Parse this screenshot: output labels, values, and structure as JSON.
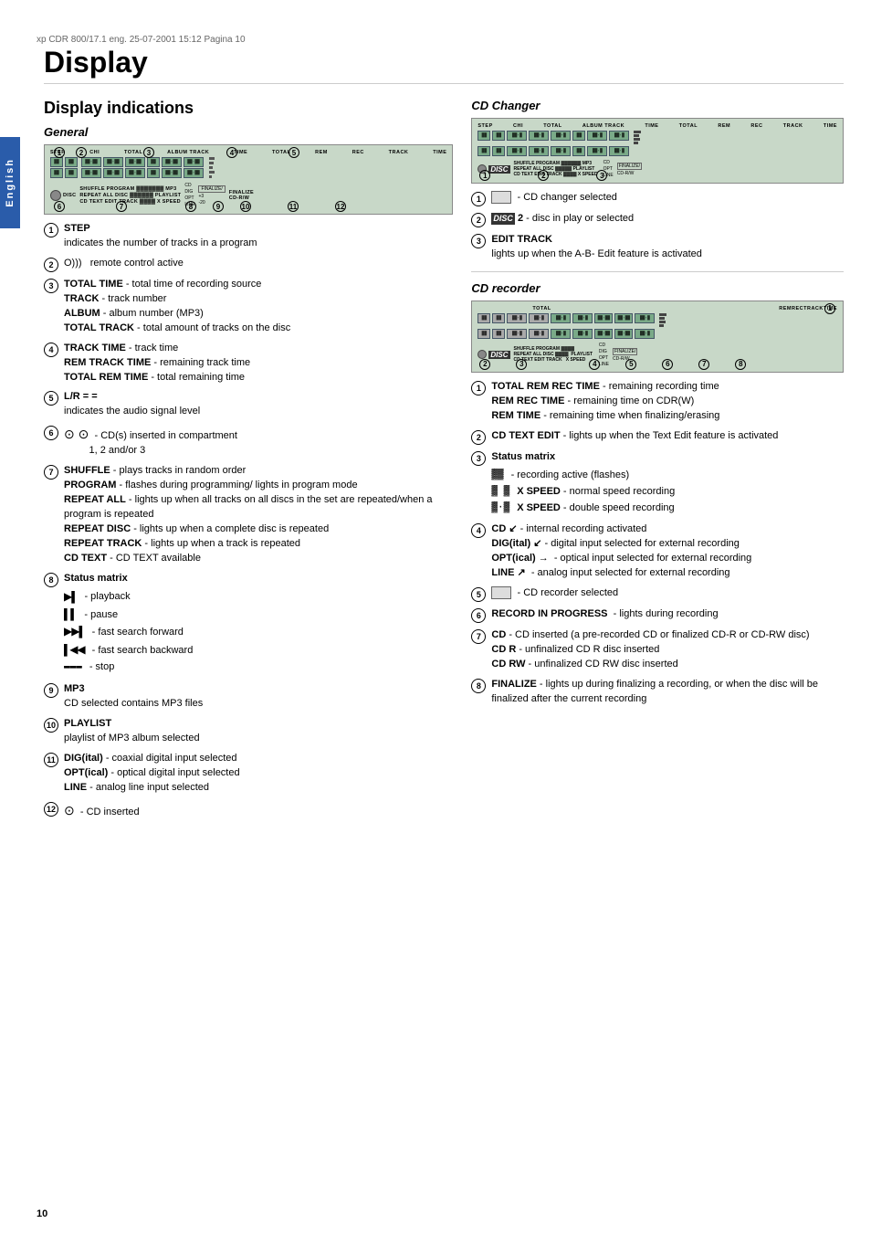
{
  "page": {
    "title": "Display",
    "number": "10",
    "side_tab": "English"
  },
  "header_note": "xp CDR 800/17.1 eng.   25-07-2001 15:12   Pagina 10",
  "left_column": {
    "section_title": "Display indications",
    "subsection_general": "General",
    "items": [
      {
        "num": "1",
        "content": "STEP",
        "detail": "indicates the number of tracks in a program"
      },
      {
        "num": "2",
        "content": "remote control active",
        "detail": ""
      },
      {
        "num": "3",
        "lines": [
          "TOTAL TIME - total time of recording source",
          "TRACK - track number",
          "ALBUM - album number (MP3)",
          "TOTAL TRACK - total amount of tracks on the disc"
        ]
      },
      {
        "num": "4",
        "lines": [
          "TRACK TIME - track time",
          "REM TRACK TIME - remaining track time",
          "TOTAL REM TIME - total remaining time"
        ]
      },
      {
        "num": "5",
        "content": "L/R = =",
        "detail": "indicates the audio signal level"
      },
      {
        "num": "6",
        "lines": [
          "CD(s) inserted in compartment 1, 2 and/or 3"
        ]
      },
      {
        "num": "7",
        "lines": [
          "SHUFFLE - plays tracks in random order",
          "PROGRAM - flashes during programming/ lights in program mode",
          "REPEAT ALL - lights up when all tracks on all discs in the set are repeated/when a program is repeated",
          "REPEAT DISC - lights up when a complete disc is repeated",
          "REPEAT TRACK - lights up when a track is repeated",
          "CD TEXT - CD TEXT available"
        ]
      },
      {
        "num": "8",
        "content": "Status matrix",
        "matrix": [
          {
            "icon": "▶▌",
            "label": "- playback"
          },
          {
            "icon": "▌▌",
            "label": "- pause"
          },
          {
            "icon": "▶▶▌",
            "label": "- fast search forward"
          },
          {
            "icon": "▌◀◀",
            "label": "- fast search backward"
          },
          {
            "icon": "▬▬▬",
            "label": "- stop"
          }
        ]
      },
      {
        "num": "9",
        "content": "MP3",
        "detail": "CD selected contains MP3 files"
      },
      {
        "num": "10",
        "content": "PLAYLIST",
        "detail": "playlist of MP3 album selected"
      },
      {
        "num": "11",
        "lines": [
          "DIG(ital) - coaxial digital input selected",
          "OPT(ical) - optical digital input selected",
          "LINE - analog line input selected"
        ]
      },
      {
        "num": "12",
        "lines": [
          "- CD inserted"
        ]
      }
    ]
  },
  "right_column": {
    "cd_changer": {
      "title": "CD Changer",
      "items": [
        {
          "num": "1",
          "content": "- CD changer selected"
        },
        {
          "num": "2",
          "content": "DISC 2 - disc in play or selected"
        },
        {
          "num": "3",
          "content": "EDIT TRACK",
          "detail": "lights up when the A-B- Edit feature is activated"
        }
      ]
    },
    "cd_recorder": {
      "title": "CD recorder",
      "items": [
        {
          "num": "1",
          "lines": [
            "TOTAL REM REC TIME - remaining recording time",
            "REM REC TIME - remaining time on CDR(W)",
            "REM TIME - remaining time when finalizing/erasing"
          ]
        },
        {
          "num": "2",
          "content": "CD TEXT EDIT - lights up when the Text Edit feature is activated"
        },
        {
          "num": "3",
          "content": "Status matrix",
          "matrix": [
            {
              "icon": "⬛⬛",
              "label": "- recording active (flashes)"
            },
            {
              "icon": "⬛ ⬛",
              "label": "X SPEED - normal speed recording"
            },
            {
              "icon": "⬛⬛⬛",
              "label": "X SPEED - double speed recording"
            }
          ]
        },
        {
          "num": "4",
          "lines": [
            "CD ↙ - internal recording activated",
            "DIG(ital) ↙ - digital input selected for external recording",
            "OPT(ical) → - optical input selected for external recording",
            "LINE ↗ - analog input selected for external recording"
          ]
        },
        {
          "num": "5",
          "content": "- CD recorder selected"
        },
        {
          "num": "6",
          "content": "RECORD IN PROGRESS - lights during recording"
        },
        {
          "num": "7",
          "lines": [
            "CD - CD inserted (a pre-recorded CD or finalized CD-R or CD-RW disc)",
            "CD R - unfinalized CD R disc inserted",
            "CD RW - unfinalized CD RW disc inserted"
          ]
        },
        {
          "num": "8",
          "content": "FINALIZE - lights up during finalizing a recording, or when the disc will be finalized after the current recording"
        }
      ]
    }
  },
  "diagram": {
    "labels_top": [
      "STEP",
      "CHI",
      "TOTAL",
      "ALBUM TRACK",
      "TIME",
      "TOTAL",
      "REM",
      "REC",
      "TRACK",
      "TIME"
    ],
    "labels_bottom": [
      "DISC",
      "SHUFFLE PROGRAM",
      "MP3",
      "CD",
      "FINALIZE/",
      ""
    ],
    "labels_bottom2": [
      "REPEAT ALL DISC",
      "PLAYLIST",
      "DIG",
      "CD-R/W"
    ],
    "labels_bottom3": [
      "CD TEXT",
      "EDIT TRACK",
      "X SPEED",
      "OPT",
      ""
    ],
    "ann_positions": [
      "1",
      "2",
      "3",
      "4",
      "5",
      "6",
      "7",
      "8",
      "9",
      "10",
      "11",
      "12"
    ]
  }
}
